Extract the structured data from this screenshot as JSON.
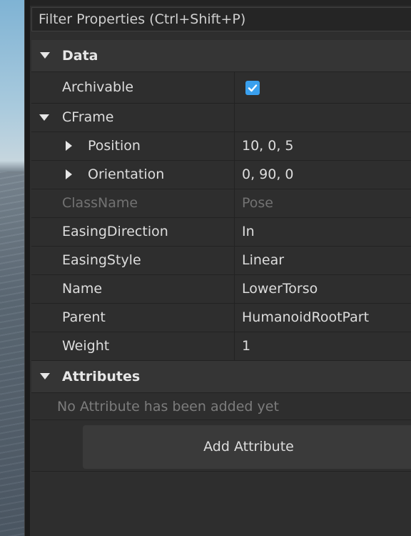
{
  "filter": {
    "placeholder": "Filter Properties (Ctrl+Shift+P)"
  },
  "sections": {
    "data": {
      "label": "Data",
      "archivable": {
        "name": "Archivable",
        "checked": true
      },
      "cframe": {
        "name": "CFrame"
      },
      "position": {
        "name": "Position",
        "value": "10, 0, 5"
      },
      "orientation": {
        "name": "Orientation",
        "value": "0, 90, 0"
      },
      "classname": {
        "name": "ClassName",
        "value": "Pose"
      },
      "easing_direction": {
        "name": "EasingDirection",
        "value": "In"
      },
      "easing_style": {
        "name": "EasingStyle",
        "value": "Linear"
      },
      "name_prop": {
        "name": "Name",
        "value": "LowerTorso"
      },
      "parent": {
        "name": "Parent",
        "value": "HumanoidRootPart"
      },
      "weight": {
        "name": "Weight",
        "value": "1"
      }
    },
    "attributes": {
      "label": "Attributes",
      "empty_message": "No Attribute has been added yet",
      "add_button_label": "Add Attribute"
    }
  },
  "colors": {
    "accent": "#3aa0ee",
    "panel": "#2e2e2e",
    "section": "#353535",
    "disabled_text": "#727272"
  },
  "icons": [
    "collapse-arrow-icon",
    "expand-arrow-icon",
    "checkmark-icon"
  ]
}
